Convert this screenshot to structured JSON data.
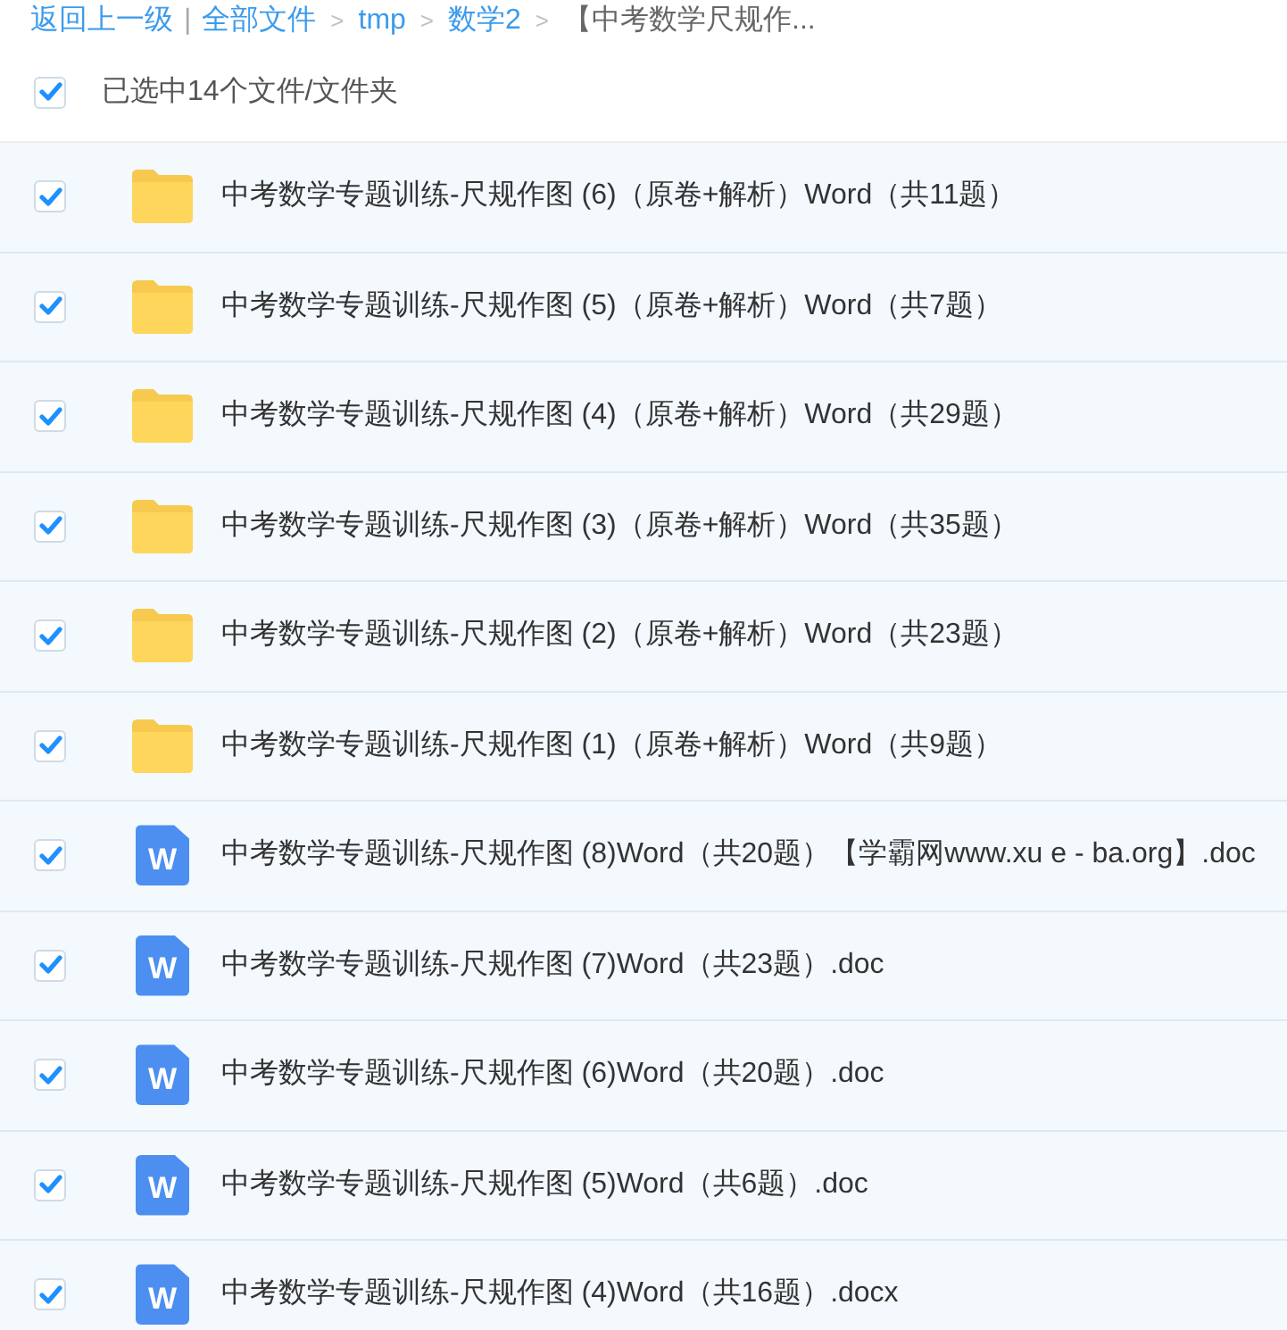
{
  "breadcrumb": {
    "back": "返回上一级",
    "separator": "|",
    "items": [
      {
        "label": "全部文件",
        "kind": "link"
      },
      {
        "label": "tmp",
        "kind": "link"
      },
      {
        "label": "数学2",
        "kind": "link"
      },
      {
        "label": "【中考数学尺规作...",
        "kind": "current"
      }
    ],
    "arrow": ">"
  },
  "select_all": {
    "checked": true,
    "label": "已选中14个文件/文件夹"
  },
  "files": [
    {
      "kind": "folder",
      "name": "中考数学专题训练-尺规作图 (6)（原卷+解析）Word（共11题）",
      "checked": true
    },
    {
      "kind": "folder",
      "name": "中考数学专题训练-尺规作图 (5)（原卷+解析）Word（共7题）",
      "checked": true
    },
    {
      "kind": "folder",
      "name": "中考数学专题训练-尺规作图 (4)（原卷+解析）Word（共29题）",
      "checked": true
    },
    {
      "kind": "folder",
      "name": "中考数学专题训练-尺规作图 (3)（原卷+解析）Word（共35题）",
      "checked": true
    },
    {
      "kind": "folder",
      "name": "中考数学专题训练-尺规作图 (2)（原卷+解析）Word（共23题）",
      "checked": true
    },
    {
      "kind": "folder",
      "name": "中考数学专题训练-尺规作图 (1)（原卷+解析）Word（共9题）",
      "checked": true
    },
    {
      "kind": "word",
      "icon_letter": "W",
      "name": "中考数学专题训练-尺规作图 (8)Word（共20题）【学霸网www.xu e - ba.org】.doc",
      "checked": true
    },
    {
      "kind": "word",
      "icon_letter": "W",
      "name": "中考数学专题训练-尺规作图 (7)Word（共23题）.doc",
      "checked": true
    },
    {
      "kind": "word",
      "icon_letter": "W",
      "name": "中考数学专题训练-尺规作图 (6)Word（共20题）.doc",
      "checked": true
    },
    {
      "kind": "word",
      "icon_letter": "W",
      "name": "中考数学专题训练-尺规作图 (5)Word（共6题）.doc",
      "checked": true
    },
    {
      "kind": "word",
      "icon_letter": "W",
      "name": "中考数学专题训练-尺规作图 (4)Word（共16题）.docx",
      "checked": true
    }
  ]
}
